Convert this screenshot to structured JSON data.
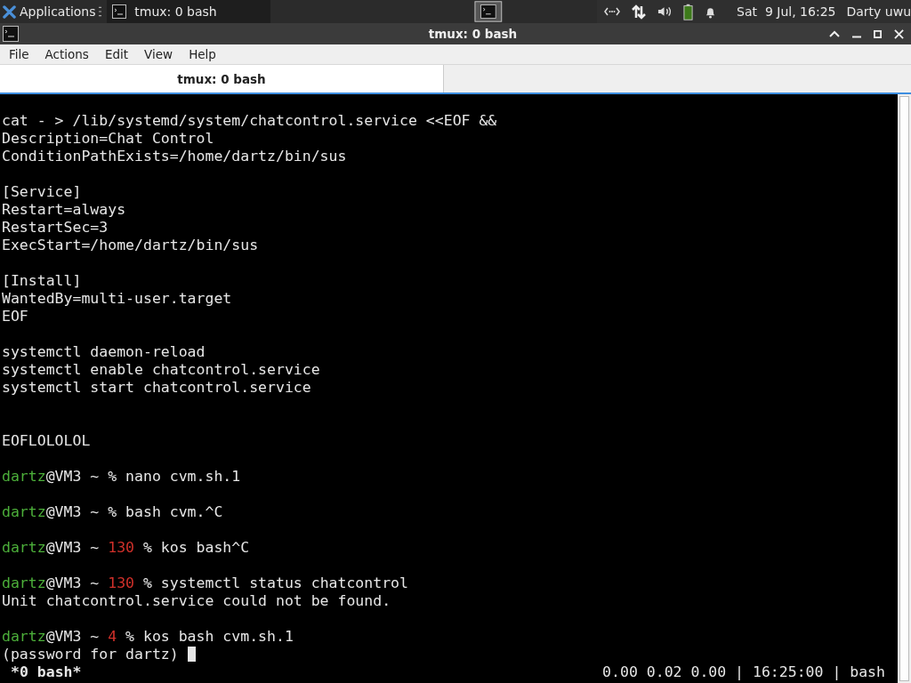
{
  "panel": {
    "applications": "Applications",
    "taskbar": [
      {
        "label": "tmux: 0 bash",
        "selected": true
      }
    ],
    "clock": "Sat  9 Jul, 16:25",
    "user": "Darty uwu"
  },
  "window": {
    "title": "tmux: 0 bash"
  },
  "menu": [
    "File",
    "Actions",
    "Edit",
    "View",
    "Help"
  ],
  "tabs": [
    {
      "label": "tmux: 0 bash",
      "selected": true
    }
  ],
  "terminal": {
    "lines": [
      {
        "kind": "text",
        "text": "cat - > /lib/systemd/system/chatcontrol.service <<EOF &&"
      },
      {
        "kind": "text",
        "text": "Description=Chat Control"
      },
      {
        "kind": "text",
        "text": "ConditionPathExists=/home/dartz/bin/sus"
      },
      {
        "kind": "blank"
      },
      {
        "kind": "text",
        "text": "[Service]"
      },
      {
        "kind": "text",
        "text": "Restart=always"
      },
      {
        "kind": "text",
        "text": "RestartSec=3"
      },
      {
        "kind": "text",
        "text": "ExecStart=/home/dartz/bin/sus"
      },
      {
        "kind": "blank"
      },
      {
        "kind": "text",
        "text": "[Install]"
      },
      {
        "kind": "text",
        "text": "WantedBy=multi-user.target"
      },
      {
        "kind": "text",
        "text": "EOF"
      },
      {
        "kind": "blank"
      },
      {
        "kind": "text",
        "text": "systemctl daemon-reload"
      },
      {
        "kind": "text",
        "text": "systemctl enable chatcontrol.service"
      },
      {
        "kind": "text",
        "text": "systemctl start chatcontrol.service"
      },
      {
        "kind": "blank"
      },
      {
        "kind": "blank"
      },
      {
        "kind": "text",
        "text": "EOFLOLOLOL"
      },
      {
        "kind": "blank"
      },
      {
        "kind": "prompt",
        "user": "dartz",
        "host": "@VM3 ~",
        "command": "% nano cvm.sh.1"
      },
      {
        "kind": "blank"
      },
      {
        "kind": "prompt",
        "user": "dartz",
        "host": "@VM3 ~",
        "command": "% bash cvm.^C"
      },
      {
        "kind": "blank"
      },
      {
        "kind": "prompt",
        "user": "dartz",
        "host": "@VM3 ~",
        "code": "130",
        "command": "% kos bash^C"
      },
      {
        "kind": "blank"
      },
      {
        "kind": "prompt",
        "user": "dartz",
        "host": "@VM3 ~",
        "code": "130",
        "command": "% systemctl status chatcontrol"
      },
      {
        "kind": "text",
        "text": "Unit chatcontrol.service could not be found."
      },
      {
        "kind": "blank"
      },
      {
        "kind": "prompt",
        "user": "dartz",
        "host": "@VM3 ~",
        "code": "4",
        "command": "% kos bash cvm.sh.1"
      },
      {
        "kind": "text",
        "text": "(password for dartz)",
        "cursor": true
      }
    ]
  },
  "status_bar": {
    "window": "*0 bash*",
    "info": "0.00 0.02 0.00 | 16:25:00 | bash"
  }
}
